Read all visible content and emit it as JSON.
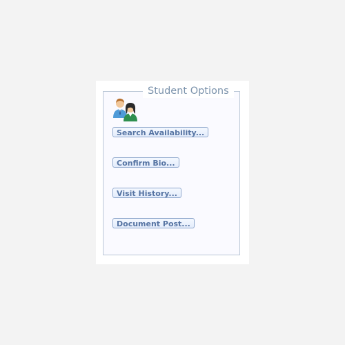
{
  "panel": {
    "title": "Student Options",
    "avatar_icon": "users-icon",
    "buttons": [
      {
        "label": "Search Availability..."
      },
      {
        "label": "Confirm Bio..."
      },
      {
        "label": "Visit History..."
      },
      {
        "label": "Document Post..."
      }
    ]
  },
  "colors": {
    "background": "#f3f3f3",
    "panel": "#ffffff",
    "border": "#b9c6d6",
    "title": "#7d94ad",
    "button_text": "#5674a3",
    "button_border": "#8ea7cc"
  }
}
